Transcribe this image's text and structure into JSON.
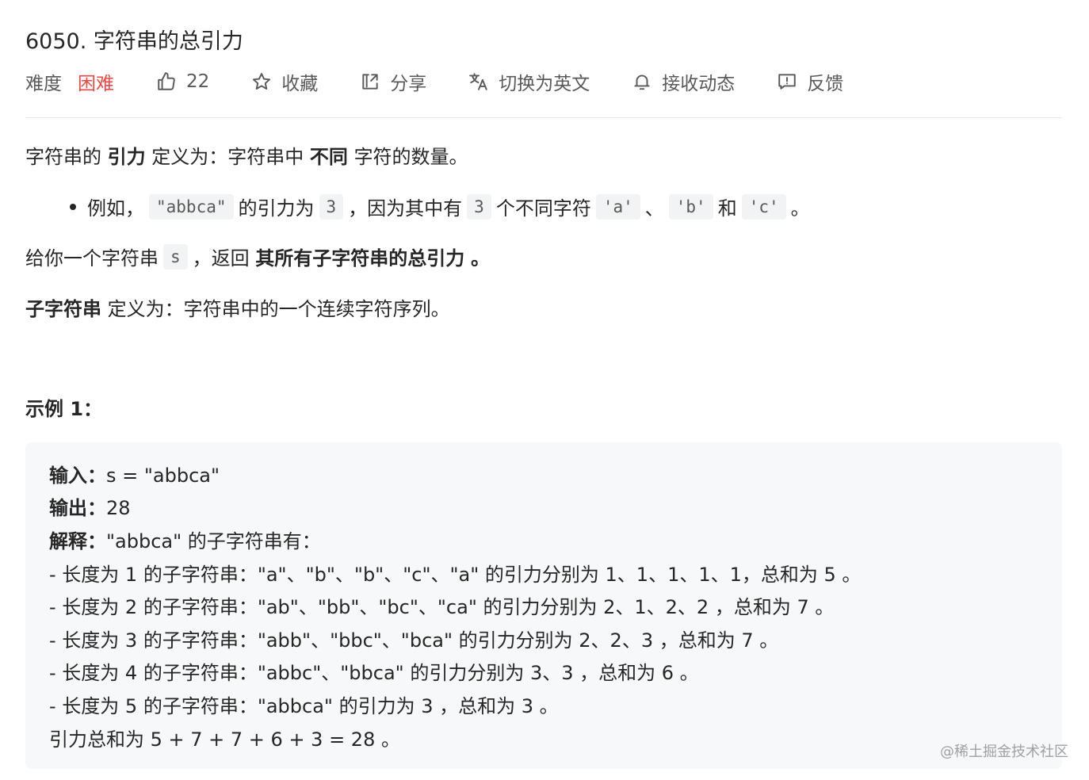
{
  "problem": {
    "title": "6050. 字符串的总引力"
  },
  "toolbar": {
    "difficulty_label": "难度",
    "difficulty_value": "困难",
    "likes": "22",
    "favorite": "收藏",
    "share": "分享",
    "translate": "切换为英文",
    "subscribe": "接收动态",
    "feedback": "反馈"
  },
  "description": {
    "p1": {
      "a": "字符串的",
      "b": "引力",
      "c": "定义为：字符串中",
      "d": "不同",
      "e": "字符的数量。"
    },
    "bullet": {
      "t1": "例如，",
      "c1": "\"abbca\"",
      "t2": "的引力为",
      "c2": "3",
      "t3": "，因为其中有",
      "c3": "3",
      "t4": "个不同字符",
      "c4": "'a'",
      "t5": "、",
      "c5": "'b'",
      "t6": "和",
      "c6": "'c'",
      "t7": "。"
    },
    "p2": {
      "a": "给你一个字符串",
      "c": "s",
      "b": "，返回",
      "d": "其所有子字符串的总引力",
      "e": "。"
    },
    "p3": {
      "a": "子字符串",
      "b": "定义为：字符串中的一个连续字符序列。"
    }
  },
  "example": {
    "title": "示例 1：",
    "input_label": "输入：",
    "input_value": "s = \"abbca\"",
    "output_label": "输出：",
    "output_value": "28",
    "explain_label": "解释：",
    "explain_value": "\"abbca\" 的子字符串有：",
    "lines": [
      "- 长度为 1 的子字符串：\"a\"、\"b\"、\"b\"、\"c\"、\"a\" 的引力分别为 1、1、1、1、1，总和为 5 。",
      "- 长度为 2 的子字符串：\"ab\"、\"bb\"、\"bc\"、\"ca\" 的引力分别为 2、1、2、2 ，总和为 7 。",
      "- 长度为 3 的子字符串：\"abb\"、\"bbc\"、\"bca\" 的引力分别为 2、2、3 ，总和为 7 。",
      "- 长度为 4 的子字符串：\"abbc\"、\"bbca\" 的引力分别为 3、3 ，总和为 6 。",
      "- 长度为 5 的子字符串：\"abbca\" 的引力为 3 ，总和为 3 。",
      "引力总和为 5 + 7 + 7 + 6 + 3 = 28 。"
    ]
  },
  "watermark": "@稀土掘金技术社区",
  "colors": {
    "difficulty_hard": "#ef4743",
    "code_bg": "#f2f3f4",
    "pre_bg": "#f7f8fa"
  }
}
